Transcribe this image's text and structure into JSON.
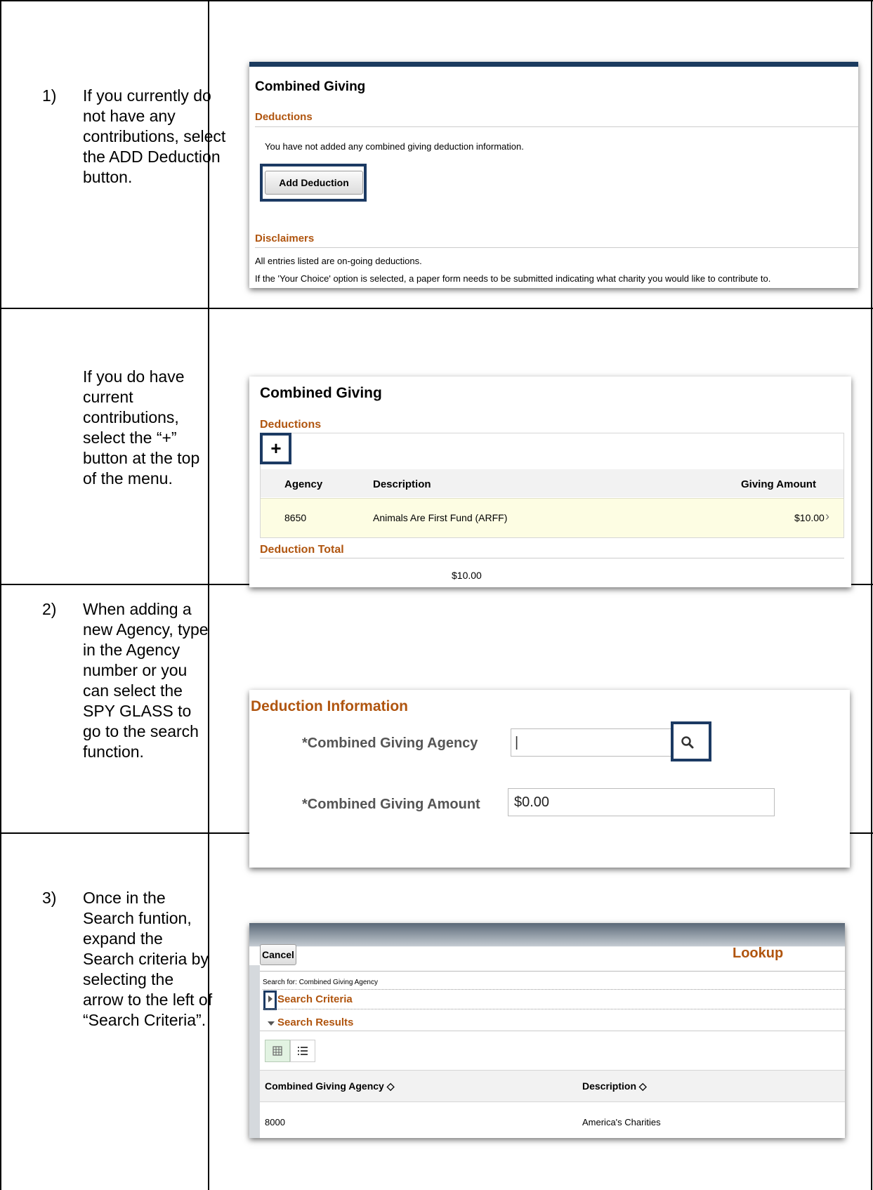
{
  "steps": [
    {
      "num": "1)",
      "text": "If you currently do not have any contributions, select the ADD Deduction button."
    },
    {
      "num": "",
      "text": "If you do have current contributions, select the “+” button at the top of the menu."
    },
    {
      "num": "2)",
      "text": "When adding a new Agency, type in the Agency number or you can select the SPY GLASS to go to the search function."
    },
    {
      "num": "3)",
      "text": "Once in the Search funtion, expand the Search criteria by selecting the arrow to the left of “Search Criteria”."
    }
  ],
  "shot1": {
    "title": "Combined Giving",
    "deductions": "Deductions",
    "empty_msg": "You have not added any combined giving deduction information.",
    "add_button": "Add Deduction",
    "disclaimers": "Disclaimers",
    "line1": "All entries listed are on-going deductions.",
    "line2": "If the 'Your Choice' option is selected, a paper form needs to be submitted indicating what charity you would like to contribute to."
  },
  "shot2": {
    "title": "Combined Giving",
    "deductions": "Deductions",
    "plus": "+",
    "col_agency": "Agency",
    "col_desc": "Description",
    "col_amount": "Giving Amount",
    "row_agency": "8650",
    "row_desc": "Animals Are First Fund (ARFF)",
    "row_amount": "$10.00",
    "row_chev": "›",
    "total_label": "Deduction Total",
    "total_value": "$10.00"
  },
  "shot3": {
    "title": "Deduction Information",
    "agency_label": "*Combined Giving Agency",
    "agency_value": "|",
    "amount_label": "*Combined Giving Amount",
    "amount_value": "$0.00"
  },
  "shot4": {
    "cancel": "Cancel",
    "lookup": "Lookup",
    "search_for": "Search for:  Combined Giving Agency",
    "criteria": "Search Criteria",
    "results": "Search Results",
    "col_agency": "Combined Giving Agency ◇",
    "col_desc": "Description ◇",
    "row_agency": "8000",
    "row_desc": "America's Charities"
  },
  "colors": {
    "accent": "#b0550f",
    "highlight": "#1c3a63",
    "navbar": "#1b3b5f"
  }
}
